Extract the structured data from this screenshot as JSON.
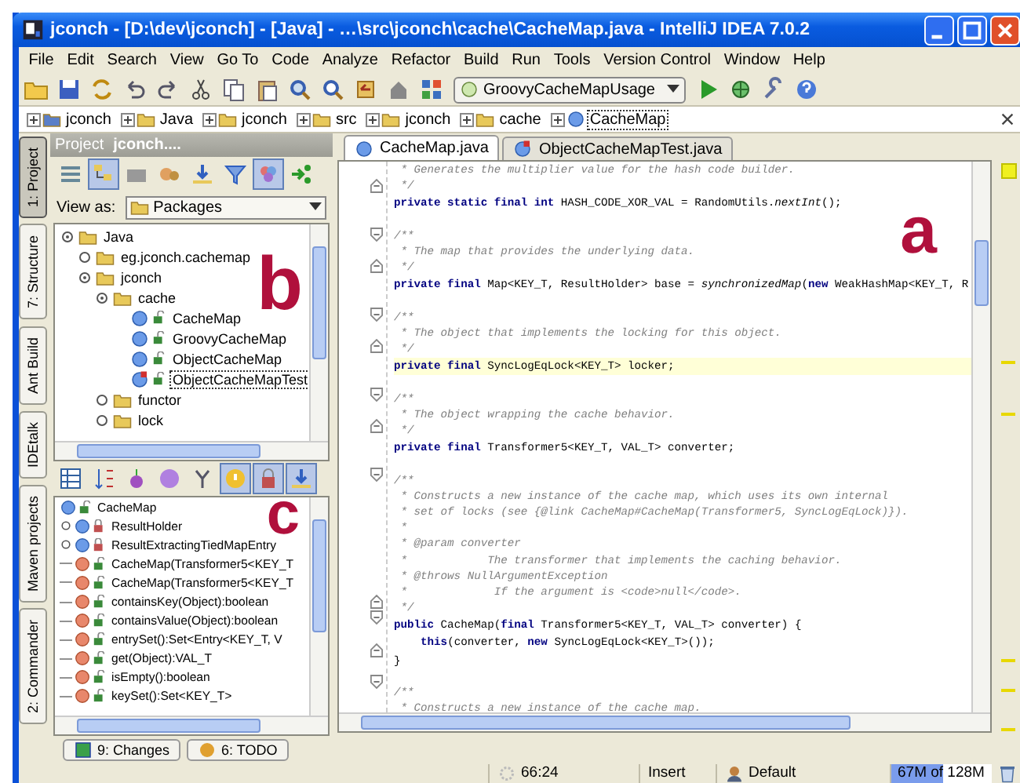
{
  "window": {
    "title": "jconch - [D:\\dev\\jconch] - [Java] - …\\src\\jconch\\cache\\CacheMap.java - IntelliJ IDEA 7.0.2"
  },
  "menu": [
    "File",
    "Edit",
    "Search",
    "View",
    "Go To",
    "Code",
    "Analyze",
    "Refactor",
    "Build",
    "Run",
    "Tools",
    "Version Control",
    "Window",
    "Help"
  ],
  "toolbar": {
    "run_config": "GroovyCacheMapUsage"
  },
  "breadcrumbs": [
    {
      "label": "jconch",
      "kind": "module",
      "selected": false
    },
    {
      "label": "Java",
      "kind": "source-folder",
      "selected": false
    },
    {
      "label": "jconch",
      "kind": "folder",
      "selected": false
    },
    {
      "label": "src",
      "kind": "package",
      "selected": false
    },
    {
      "label": "jconch",
      "kind": "package",
      "selected": false
    },
    {
      "label": "cache",
      "kind": "package",
      "selected": false
    },
    {
      "label": "CacheMap",
      "kind": "class",
      "selected": true
    }
  ],
  "side_tabs": [
    {
      "label": "1: Project",
      "selected": true
    },
    {
      "label": "7: Structure",
      "selected": false
    },
    {
      "label": "Ant Build",
      "selected": false
    },
    {
      "label": "IDEtalk",
      "selected": false
    },
    {
      "label": "Maven projects",
      "selected": false
    },
    {
      "label": "2: Commander",
      "selected": false
    }
  ],
  "project": {
    "title": "Project",
    "context": "jconch....",
    "view_as_label": "View as:",
    "view_as": "Packages",
    "callout": "b",
    "tree": [
      {
        "label": "Java",
        "kind": "source-folder",
        "expanded": true,
        "selected": false,
        "children": [
          {
            "label": "eg.jconch.cachemap",
            "kind": "package",
            "expanded": false,
            "selected": false
          },
          {
            "label": "jconch",
            "kind": "package",
            "expanded": true,
            "selected": false,
            "children": [
              {
                "label": "cache",
                "kind": "package",
                "expanded": true,
                "selected": false,
                "children": [
                  {
                    "label": "CacheMap",
                    "kind": "class",
                    "selected": false
                  },
                  {
                    "label": "GroovyCacheMap",
                    "kind": "class",
                    "selected": false
                  },
                  {
                    "label": "ObjectCacheMap",
                    "kind": "class",
                    "selected": false
                  },
                  {
                    "label": "ObjectCacheMapTest",
                    "kind": "test-class",
                    "selected": true
                  }
                ]
              },
              {
                "label": "functor",
                "kind": "package",
                "expanded": false,
                "selected": false
              },
              {
                "label": "lock",
                "kind": "package",
                "expanded": false,
                "selected": false
              }
            ]
          }
        ]
      }
    ]
  },
  "structure": {
    "callout": "c",
    "root": "CacheMap",
    "members": [
      {
        "label": "ResultHolder",
        "kind": "class",
        "private": true
      },
      {
        "label": "ResultExtractingTiedMapEntry",
        "kind": "class",
        "private": true
      },
      {
        "label": "CacheMap(Transformer5<KEY_T",
        "kind": "method",
        "private": false
      },
      {
        "label": "CacheMap(Transformer5<KEY_T",
        "kind": "method",
        "private": false
      },
      {
        "label": "containsKey(Object):boolean",
        "kind": "method",
        "private": false
      },
      {
        "label": "containsValue(Object):boolean",
        "kind": "method",
        "private": false
      },
      {
        "label": "entrySet():Set<Entry<KEY_T, V",
        "kind": "method",
        "private": false
      },
      {
        "label": "get(Object):VAL_T",
        "kind": "method",
        "private": false
      },
      {
        "label": "isEmpty():boolean",
        "kind": "method",
        "private": false
      },
      {
        "label": "keySet():Set<KEY_T>",
        "kind": "method",
        "private": false
      }
    ]
  },
  "editor": {
    "callout": "a",
    "tabs": [
      {
        "label": "CacheMap.java",
        "kind": "class",
        "selected": true
      },
      {
        "label": "ObjectCacheMapTest.java",
        "kind": "test-class",
        "selected": false
      }
    ],
    "lines": [
      {
        "kind": "comment",
        "text": " * Generates the multiplier value for the hash code builder.",
        "fold_start": false,
        "fold_end": false,
        "current": false
      },
      {
        "kind": "comment",
        "text": " */",
        "fold_start": false,
        "fold_end": true,
        "current": false
      },
      {
        "kind": "code",
        "text": "**private static final int** HASH_CODE_XOR_VAL = RandomUtils.*nextInt*();",
        "fold_start": false,
        "fold_end": false,
        "current": false
      },
      {
        "kind": "blank",
        "fold_start": false,
        "fold_end": false,
        "current": false
      },
      {
        "kind": "comment",
        "text": "/**",
        "fold_start": true,
        "fold_end": false,
        "current": false
      },
      {
        "kind": "comment",
        "text": " * The map that provides the underlying data.",
        "fold_start": false,
        "fold_end": false,
        "current": false
      },
      {
        "kind": "comment",
        "text": " */",
        "fold_start": false,
        "fold_end": true,
        "current": false
      },
      {
        "kind": "code",
        "text": "**private final** Map<KEY_T, ResultHolder> base = *synchronizedMap*(**new** WeakHashMap<KEY_T, R",
        "fold_start": false,
        "fold_end": false,
        "current": false
      },
      {
        "kind": "blank",
        "fold_start": false,
        "fold_end": false,
        "current": false
      },
      {
        "kind": "comment",
        "text": "/**",
        "fold_start": true,
        "fold_end": false,
        "current": false
      },
      {
        "kind": "comment",
        "text": " * The object that implements the locking for this object.",
        "fold_start": false,
        "fold_end": false,
        "current": false
      },
      {
        "kind": "comment",
        "text": " */",
        "fold_start": false,
        "fold_end": true,
        "current": false
      },
      {
        "kind": "code",
        "text": "**private final** SyncLogEqLock<KEY_T> locker;",
        "fold_start": false,
        "fold_end": false,
        "current": true
      },
      {
        "kind": "blank",
        "fold_start": false,
        "fold_end": false,
        "current": false
      },
      {
        "kind": "comment",
        "text": "/**",
        "fold_start": true,
        "fold_end": false,
        "current": false
      },
      {
        "kind": "comment",
        "text": " * The object wrapping the cache behavior.",
        "fold_start": false,
        "fold_end": false,
        "current": false
      },
      {
        "kind": "comment",
        "text": " */",
        "fold_start": false,
        "fold_end": true,
        "current": false
      },
      {
        "kind": "code",
        "text": "**private final** Transformer5<KEY_T, VAL_T> converter;",
        "fold_start": false,
        "fold_end": false,
        "current": false
      },
      {
        "kind": "blank",
        "fold_start": false,
        "fold_end": false,
        "current": false
      },
      {
        "kind": "comment",
        "text": "/**",
        "fold_start": true,
        "fold_end": false,
        "current": false
      },
      {
        "kind": "comment",
        "text": " * Constructs a new instance of the cache map, which uses its own internal",
        "fold_start": false,
        "fold_end": false,
        "current": false
      },
      {
        "kind": "comment",
        "text": " * set of locks (see {@link CacheMap#CacheMap(Transformer5, SyncLogEqLock)}).",
        "fold_start": false,
        "fold_end": false,
        "current": false
      },
      {
        "kind": "comment",
        "text": " *",
        "fold_start": false,
        "fold_end": false,
        "current": false
      },
      {
        "kind": "comment",
        "text": " * @param converter",
        "fold_start": false,
        "fold_end": false,
        "current": false
      },
      {
        "kind": "comment",
        "text": " *            The transformer that implements the caching behavior.",
        "fold_start": false,
        "fold_end": false,
        "current": false
      },
      {
        "kind": "comment",
        "text": " * @throws NullArgumentException",
        "fold_start": false,
        "fold_end": false,
        "current": false
      },
      {
        "kind": "comment",
        "text": " *             If the argument is <code>null</code>.",
        "fold_start": false,
        "fold_end": false,
        "current": false
      },
      {
        "kind": "comment",
        "text": " */",
        "fold_start": false,
        "fold_end": true,
        "current": false
      },
      {
        "kind": "code",
        "text": "**public** CacheMap(**final** Transformer5<KEY_T, VAL_T> converter) {",
        "fold_start": true,
        "fold_end": false,
        "current": false
      },
      {
        "kind": "code",
        "text": "    **this**(converter, **new** SyncLogEqLock<KEY_T>());",
        "fold_start": false,
        "fold_end": false,
        "current": false
      },
      {
        "kind": "code",
        "text": "}",
        "fold_start": false,
        "fold_end": true,
        "current": false
      },
      {
        "kind": "blank",
        "fold_start": false,
        "fold_end": false,
        "current": false
      },
      {
        "kind": "comment",
        "text": "/**",
        "fold_start": true,
        "fold_end": false,
        "current": false
      },
      {
        "kind": "comment",
        "text": " * Constructs a new instance of the cache map.",
        "fold_start": false,
        "fold_end": false,
        "current": false
      }
    ]
  },
  "tool_tabs": [
    {
      "label": "9: Changes",
      "kind": "changes"
    },
    {
      "label": "6: TODO",
      "kind": "todo"
    }
  ],
  "status_bar": {
    "position": "66:24",
    "mode": "Insert",
    "scheme": "Default",
    "memory": "67M of 128M",
    "level": 0.52
  }
}
